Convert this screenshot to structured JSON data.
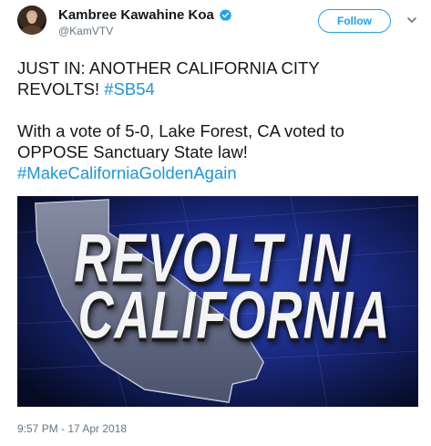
{
  "author": {
    "name": "Kambree Kawahine Koa",
    "handle": "@KamVTV",
    "verified": true
  },
  "actions": {
    "follow_label": "Follow",
    "menu_icon": "chevron-down-icon"
  },
  "tweet": {
    "line1": "JUST IN: ANOTHER CALIFORNIA CITY",
    "line2_text": "REVOLTS! ",
    "line2_hashtag": "#SB54",
    "line3": "With a vote of 5-0, Lake Forest, CA voted to",
    "line4": "OPPOSE Sanctuary State law!",
    "line5_hashtag": "#MakeCaliforniaGoldenAgain"
  },
  "media": {
    "headline_line1": "REVOLT IN",
    "headline_line2": "CALIFORNIA"
  },
  "timestamp": "9:57 PM - 17 Apr 2018",
  "colors": {
    "link": "#1b95e0",
    "follow": "#1da1f2",
    "muted": "#657786"
  }
}
